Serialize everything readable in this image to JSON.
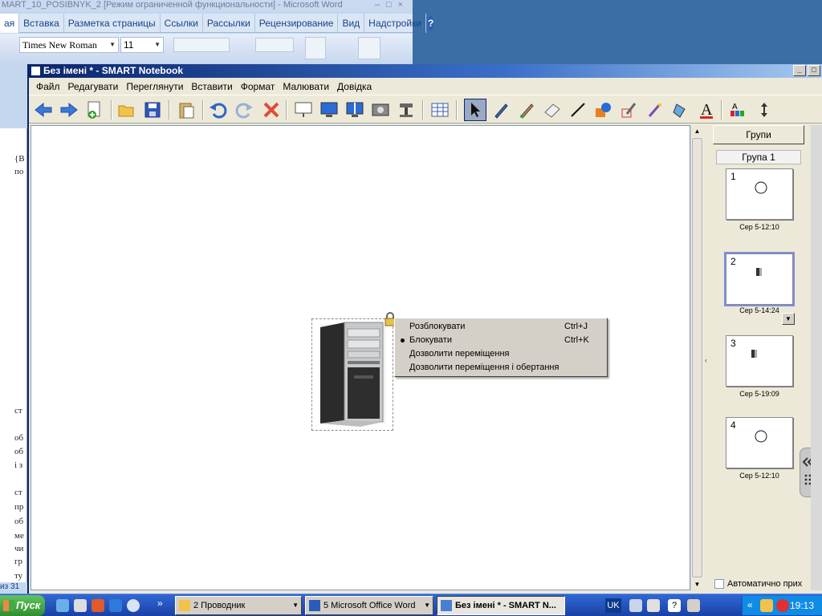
{
  "word": {
    "title": "MART_10_POSIBNYK_2 [Режим ограниченной функциональности] - Microsoft Word",
    "tabs": [
      "ая",
      "Вставка",
      "Разметка страницы",
      "Ссылки",
      "Рассылки",
      "Рецензирование",
      "Вид",
      "Надстройки"
    ],
    "font_name": "Times New Roman",
    "font_size": "11",
    "page_status": "из 31",
    "doc_fragments": [
      "{В",
      "по",
      "ст",
      "об",
      "об",
      "і з",
      "ст",
      "пр",
      "об",
      "ме",
      "чи",
      "гр",
      "ту"
    ]
  },
  "notebook": {
    "title": "Без імені * - SMART Notebook",
    "menu": [
      "Файл",
      "Редагувати",
      "Переглянути",
      "Вставити",
      "Формат",
      "Малювати",
      "Довідка"
    ],
    "context_menu": [
      {
        "label": "Розблокувати",
        "shortcut": "Ctrl+J",
        "checked": false
      },
      {
        "label": "Блокувати",
        "shortcut": "Ctrl+K",
        "checked": true
      },
      {
        "label": "Дозволити переміщення",
        "shortcut": "",
        "checked": false
      },
      {
        "label": "Дозволити переміщення і обертання",
        "shortcut": "",
        "checked": false
      }
    ],
    "sorter": {
      "groups_button": "Групи",
      "group_label": "Група 1",
      "pages": [
        {
          "num": "1",
          "label": "Сер 5-12:10",
          "content": "circle"
        },
        {
          "num": "2",
          "label": "Сер 5-14:24",
          "content": "computer",
          "selected": true
        },
        {
          "num": "3",
          "label": "Сер 5-19:09",
          "content": "computer"
        },
        {
          "num": "4",
          "label": "Сер 5-12:10",
          "content": "circle"
        }
      ],
      "autohide_label": "Автоматично прих"
    }
  },
  "taskbar": {
    "start": "Пуск",
    "buttons": [
      {
        "label": "2 Проводник",
        "icon": "folder-icon"
      },
      {
        "label": "5 Microsoft Office Word",
        "icon": "word-icon"
      },
      {
        "label": "Без імені * - SMART N...",
        "icon": "notebook-icon"
      }
    ],
    "lang": "UK",
    "clock": "19:13"
  }
}
